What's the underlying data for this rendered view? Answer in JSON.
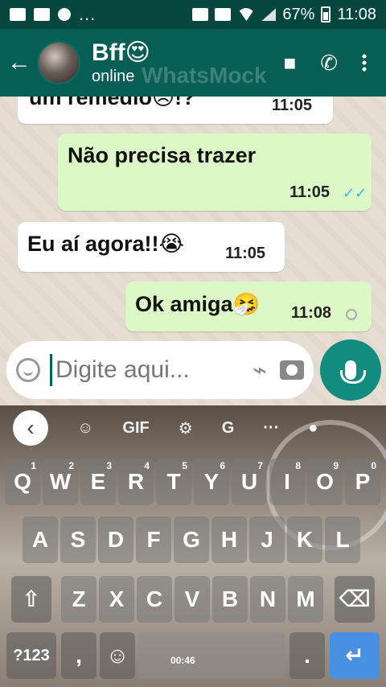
{
  "status_bar": {
    "dots": "...",
    "battery": "67%",
    "time": "11:08"
  },
  "header": {
    "title": "Bff😍",
    "subtitle": "online",
    "watermark": "WhatsMock"
  },
  "messages": [
    {
      "side": "in",
      "text": "um remédio😣!?",
      "time": "11:05"
    },
    {
      "side": "out",
      "text": "Não precisa trazer",
      "time": "11:05",
      "status": "read"
    },
    {
      "side": "in",
      "text": "Eu aí agora!!😭",
      "time": "11:05"
    },
    {
      "side": "out",
      "text": "Ok amiga🤧",
      "time": "11:08",
      "status": "pending"
    }
  ],
  "composer": {
    "placeholder": "Digite aqui..."
  },
  "keyboard": {
    "toolbar": [
      "GIF"
    ],
    "row1": [
      {
        "k": "Q",
        "h": "1"
      },
      {
        "k": "W",
        "h": "2"
      },
      {
        "k": "E",
        "h": "3"
      },
      {
        "k": "R",
        "h": "4"
      },
      {
        "k": "T",
        "h": "5"
      },
      {
        "k": "Y",
        "h": "6"
      },
      {
        "k": "U",
        "h": "7"
      },
      {
        "k": "I",
        "h": "8"
      },
      {
        "k": "O",
        "h": "9"
      },
      {
        "k": "P",
        "h": "0"
      }
    ],
    "row2": [
      "A",
      "S",
      "D",
      "F",
      "G",
      "H",
      "J",
      "K",
      "L"
    ],
    "row3": [
      "Z",
      "X",
      "C",
      "V",
      "B",
      "N",
      "M"
    ],
    "symbols": "?123",
    "comma": ",",
    "period": ".",
    "spacebar_time": "00:46"
  }
}
